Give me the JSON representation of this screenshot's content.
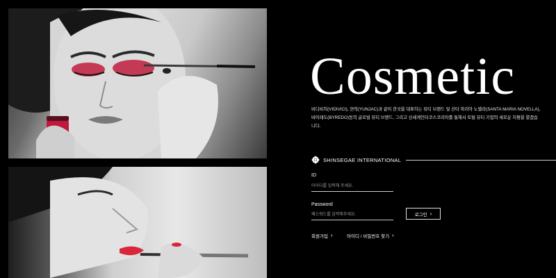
{
  "hero": {
    "title": "Cosmetic",
    "description": "비디비치(VIDIVICI), 연작(YUNJAC)과 같이 한국을 대표하는 뷰티 브랜드 및 산타 마리아 노벨라(SANTA MARIA NOVELLA), 바이레도(BYREDO)등의 글로벌 뷰티 브랜드, 그리고 신세계인터코스코리아를 통해서 토털 뷰티 기업의 새로운 지평을 열겠습니다."
  },
  "brand": {
    "icon": "flower-logo-icon",
    "name": "SHINSEGAE INTERNATIONAL"
  },
  "login_form": {
    "id_label": "ID",
    "id_placeholder": "아이디를 입력해 주세요.",
    "password_label": "Password",
    "password_placeholder": "패스워드를 입력해주세요.",
    "login_button": "로그인",
    "links": {
      "signup": "회원가입",
      "find": "아이디 / 비밀번호 찾기"
    }
  },
  "colors": {
    "background": "#000000",
    "accent_red": "#d8263a",
    "text": "#ffffff"
  }
}
